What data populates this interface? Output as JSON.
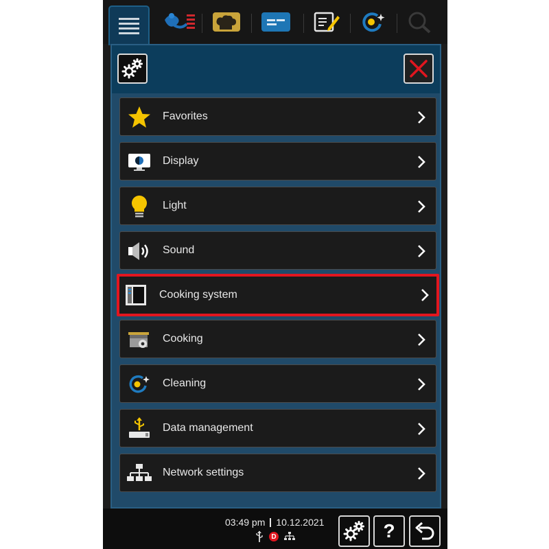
{
  "colors": {
    "accent_blue": "#0c3d5c",
    "panel_blue": "#204a69",
    "highlight_red": "#e1161f",
    "row_bg": "#1b1b1b",
    "star_yellow": "#f5c400"
  },
  "tabs": [
    {
      "icon": "menu-icon",
      "active": true
    },
    {
      "icon": "intelligent-cooking-icon",
      "active": false
    },
    {
      "icon": "chef-hat-icon",
      "active": false
    },
    {
      "icon": "cooking-paths-icon",
      "active": false
    },
    {
      "icon": "edit-program-icon",
      "active": false
    },
    {
      "icon": "cleaning-icon",
      "active": false
    },
    {
      "icon": "search-icon",
      "active": false
    }
  ],
  "header": {
    "settings_icon": "gear-icon",
    "close_icon": "close-icon"
  },
  "menu": {
    "items": [
      {
        "label": "Favorites",
        "icon": "star-icon"
      },
      {
        "label": "Display",
        "icon": "display-icon"
      },
      {
        "label": "Light",
        "icon": "light-bulb-icon"
      },
      {
        "label": "Sound",
        "icon": "speaker-icon"
      },
      {
        "label": "Cooking system",
        "icon": "cooking-system-icon",
        "highlighted": true
      },
      {
        "label": "Cooking",
        "icon": "cooking-pot-icon"
      },
      {
        "label": "Cleaning",
        "icon": "cleaning-icon"
      },
      {
        "label": "Data management",
        "icon": "usb-icon"
      },
      {
        "label": "Network settings",
        "icon": "network-icon"
      }
    ]
  },
  "status": {
    "time": "03:49 pm",
    "date": "10.12.2021",
    "badge": "D"
  },
  "footer": {
    "settings_icon": "gear-icon",
    "help_label": "?",
    "back_icon": "back-arrow-icon"
  }
}
